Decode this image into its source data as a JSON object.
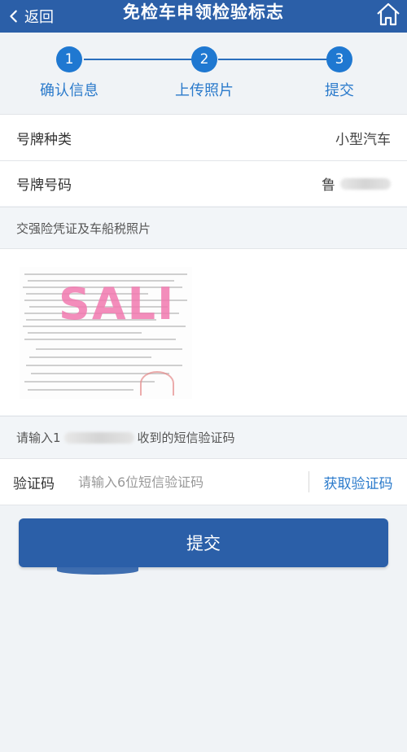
{
  "nav": {
    "back_label": "返回",
    "title": "免检车申领检验标志",
    "back_icon": "chevron-left-icon",
    "home_icon": "home-icon"
  },
  "steps": [
    {
      "number": "1",
      "label": "确认信息"
    },
    {
      "number": "2",
      "label": "上传照片"
    },
    {
      "number": "3",
      "label": "提交"
    }
  ],
  "plate_type": {
    "label": "号牌种类",
    "value": "小型汽车"
  },
  "plate_number": {
    "label": "号牌号码",
    "value_prefix": "鲁"
  },
  "photo_section": {
    "title": "交强险凭证及车船税照片",
    "watermark": "SALI"
  },
  "sms": {
    "hint_prefix": "请输入1",
    "hint_suffix": "收到的短信验证码"
  },
  "code": {
    "label": "验证码",
    "placeholder": "请输入6位短信验证码",
    "value": "",
    "get_code_label": "获取验证码"
  },
  "submit_label": "提交",
  "colors": {
    "primary": "#2b5fa8",
    "accent": "#1f78d1",
    "link": "#2a7acb",
    "watermark": "#f27ab0"
  }
}
